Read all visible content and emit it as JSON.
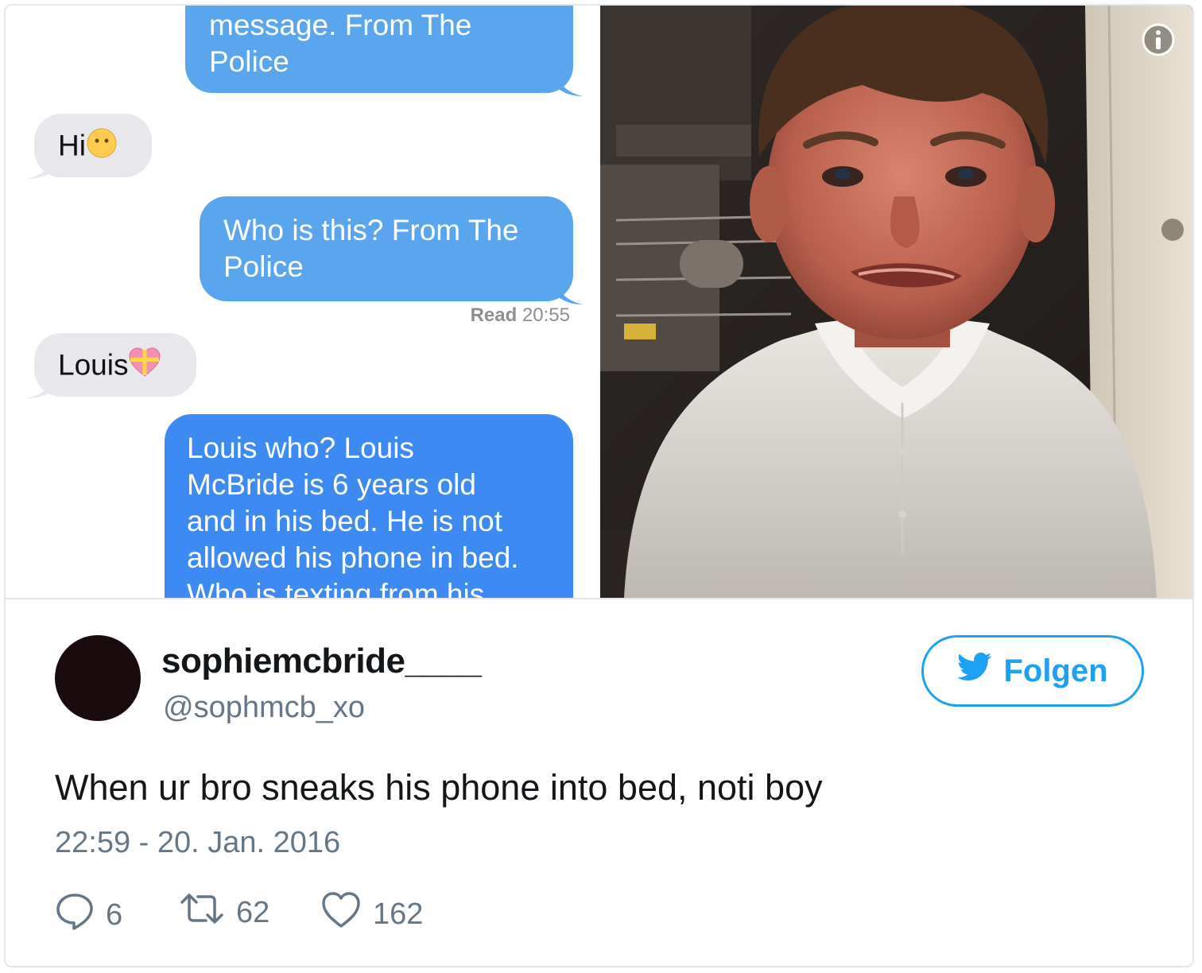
{
  "messages": [
    {
      "type": "sent",
      "text_line1": "message. From The",
      "text_line2": "Police"
    },
    {
      "type": "received",
      "text": "Hi",
      "emoji": "no-mouth-face-emoji"
    },
    {
      "type": "sent",
      "text_line1": "Who is this? From The",
      "text_line2": "Police"
    },
    {
      "type": "status",
      "label": "Read",
      "time": "20:55"
    },
    {
      "type": "received",
      "text": "Louis",
      "emoji": "gift-heart-emoji"
    },
    {
      "type": "sent",
      "lines": [
        "Louis who? Louis",
        "McBride is 6 years old",
        "and in his bed. He is not",
        "allowed his phone in bed.",
        "Who is texting from his"
      ]
    }
  ],
  "photo": {
    "description_icon": "info-icon"
  },
  "author": {
    "display_name": "sophiemcbride____",
    "handle": "@sophmcb_xo"
  },
  "follow_button": {
    "label": "Folgen",
    "icon": "twitter-bird-icon"
  },
  "tweet": {
    "text": "When ur bro sneaks his phone into bed, noti boy",
    "timestamp": "22:59 - 20. Jan. 2016"
  },
  "stats": {
    "replies": "6",
    "retweets": "62",
    "likes": "162"
  },
  "colors": {
    "sent_bubble": "#5aa6ee",
    "sent_bubble_dark": "#3d8bf2",
    "received_bubble": "#e7e7ec",
    "accent": "#1da1f2",
    "muted": "#657786"
  }
}
